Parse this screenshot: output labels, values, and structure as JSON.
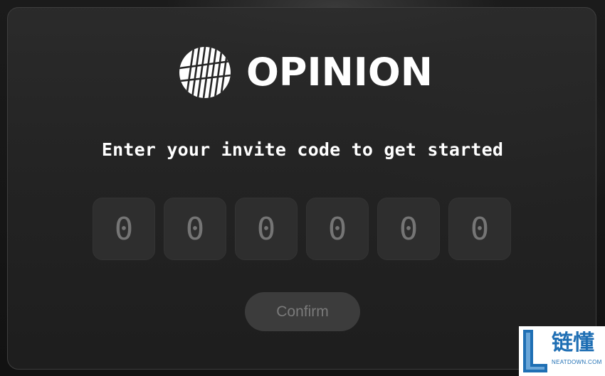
{
  "brand": {
    "wordmark": "OPINION",
    "logo_icon": "opinion-striped-circle-logo"
  },
  "headline": "Enter your invite code to get started",
  "invite_code": {
    "length": 6,
    "placeholders": [
      "0",
      "0",
      "0",
      "0",
      "0",
      "0"
    ]
  },
  "confirm_button": {
    "label": "Confirm",
    "state": "disabled"
  },
  "watermark": {
    "text_cn": "链懂",
    "text_en": "NEATDOWN.COM"
  },
  "colors": {
    "background": "#141414",
    "card": "#262626",
    "code_box": "#2e2e2e",
    "button": "#3c3c3c",
    "button_text": "#7a7a7a",
    "text": "#ffffff",
    "watermark_blue": "#1f6fb4"
  }
}
